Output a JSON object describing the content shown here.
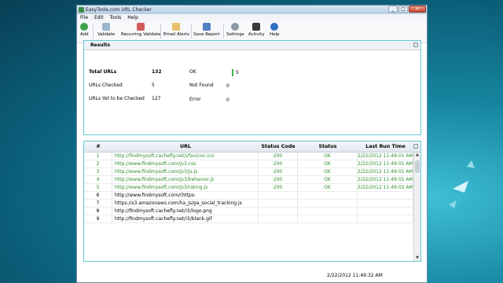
{
  "window": {
    "title": "EasyTools.com URL Checker",
    "minimize": "_",
    "maximize": "□",
    "close": "✕"
  },
  "menu": [
    "File",
    "Edit",
    "Tools",
    "Help"
  ],
  "toolbar": {
    "add": "Add",
    "validate": "Validate",
    "recurring_validate": "Recurring Validate",
    "email_alerts": "Email Alerts",
    "save_report": "Save Report",
    "settings": "Settings",
    "activity": "Activity",
    "help": "Help"
  },
  "results": {
    "header": "Results",
    "total_label": "Total URLs",
    "total_value": "132",
    "checked_label": "URLs Checked",
    "checked_value": "5",
    "pending_label": "URLs Yet to be Checked",
    "pending_value": "127",
    "ok_label": "OK",
    "ok_value": "5",
    "notfound_label": "Not Found",
    "notfound_value": "0",
    "error_label": "Error",
    "error_value": "0"
  },
  "grid": {
    "columns": [
      "#",
      "URL",
      "Status Code",
      "Status",
      "Last Run Time"
    ],
    "rows": [
      {
        "num": "1",
        "url": "http://findmysoft.cachefly.net/i/favicon.ico",
        "code": "200",
        "status": "OK",
        "time": "2/22/2012 11:49:01 AM"
      },
      {
        "num": "2",
        "url": "http://www.findmysoft.com/js3.css",
        "code": "200",
        "status": "OK",
        "time": "2/22/2012 11:49:01 AM"
      },
      {
        "num": "3",
        "url": "http://www.findmysoft.com/js3/js.js",
        "code": "200",
        "status": "OK",
        "time": "2/22/2012 11:49:01 AM"
      },
      {
        "num": "4",
        "url": "http://www.findmysoft.com/js3/behavior.js",
        "code": "200",
        "status": "OK",
        "time": "2/22/2012 11:49:01 AM"
      },
      {
        "num": "5",
        "url": "http://www.findmysoft.com/js3/rating.js",
        "code": "200",
        "status": "OK",
        "time": "2/22/2012 11:49:02 AM"
      },
      {
        "num": "6",
        "url": "http://www.findmysoft.com/(https:",
        "code": "",
        "status": "",
        "time": ""
      },
      {
        "num": "7",
        "url": "https://s3.amazonaws.com/ha_js/ga_social_tracking.js",
        "code": "",
        "status": "",
        "time": ""
      },
      {
        "num": "8",
        "url": "http://findmysoft.cachefly.net/i3/logo.png",
        "code": "",
        "status": "",
        "time": ""
      },
      {
        "num": "9",
        "url": "http://findmysoft.cachefly.net/i3/blank.gif",
        "code": "",
        "status": "",
        "time": ""
      }
    ]
  },
  "statusbar": {
    "timestamp": "2/22/2012 11:49:32 AM"
  },
  "colors": {
    "ok_green": "#2e8f2e",
    "panel_border": "#66c7d4"
  },
  "icons": [
    "add-icon",
    "validate-icon",
    "recurring-validate-icon",
    "email-alerts-icon",
    "save-report-icon",
    "settings-icon",
    "activity-icon",
    "help-icon"
  ]
}
